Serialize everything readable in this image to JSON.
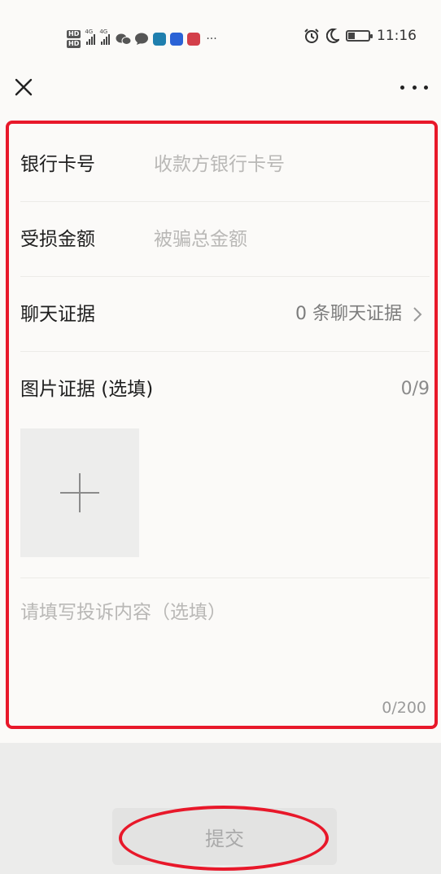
{
  "status_bar": {
    "time": "11:16",
    "hd_badges": [
      "HD",
      "HD"
    ],
    "network_labels": [
      "4G",
      "4G"
    ],
    "battery_level": 0.35,
    "more_indicator": "···",
    "icons": [
      "signal-icon",
      "wechat-icon",
      "message-icon",
      "app-icon",
      "app-icon",
      "app-icon",
      "alarm-icon",
      "moon-icon",
      "battery-icon"
    ]
  },
  "nav": {
    "close_icon": "close-icon",
    "more_icon": "more-icon"
  },
  "form": {
    "bank_card": {
      "label": "银行卡号",
      "placeholder": "收款方银行卡号",
      "value": ""
    },
    "loss_amount": {
      "label": "受损金额",
      "placeholder": "被骗总金额",
      "value": ""
    },
    "chat_evidence": {
      "label": "聊天证据",
      "value": "0 条聊天证据"
    },
    "image_evidence": {
      "label": "图片证据 (选填)",
      "count": "0/9"
    },
    "complaint": {
      "placeholder": "请填写投诉内容（选填）",
      "value": "",
      "counter": "0/200"
    }
  },
  "submit": {
    "label": "提交"
  },
  "colors": {
    "background": "#fbfaf8",
    "annotation_red": "#e8182a",
    "placeholder": "#b9b8b6",
    "bottom_panel": "#ececeb"
  }
}
